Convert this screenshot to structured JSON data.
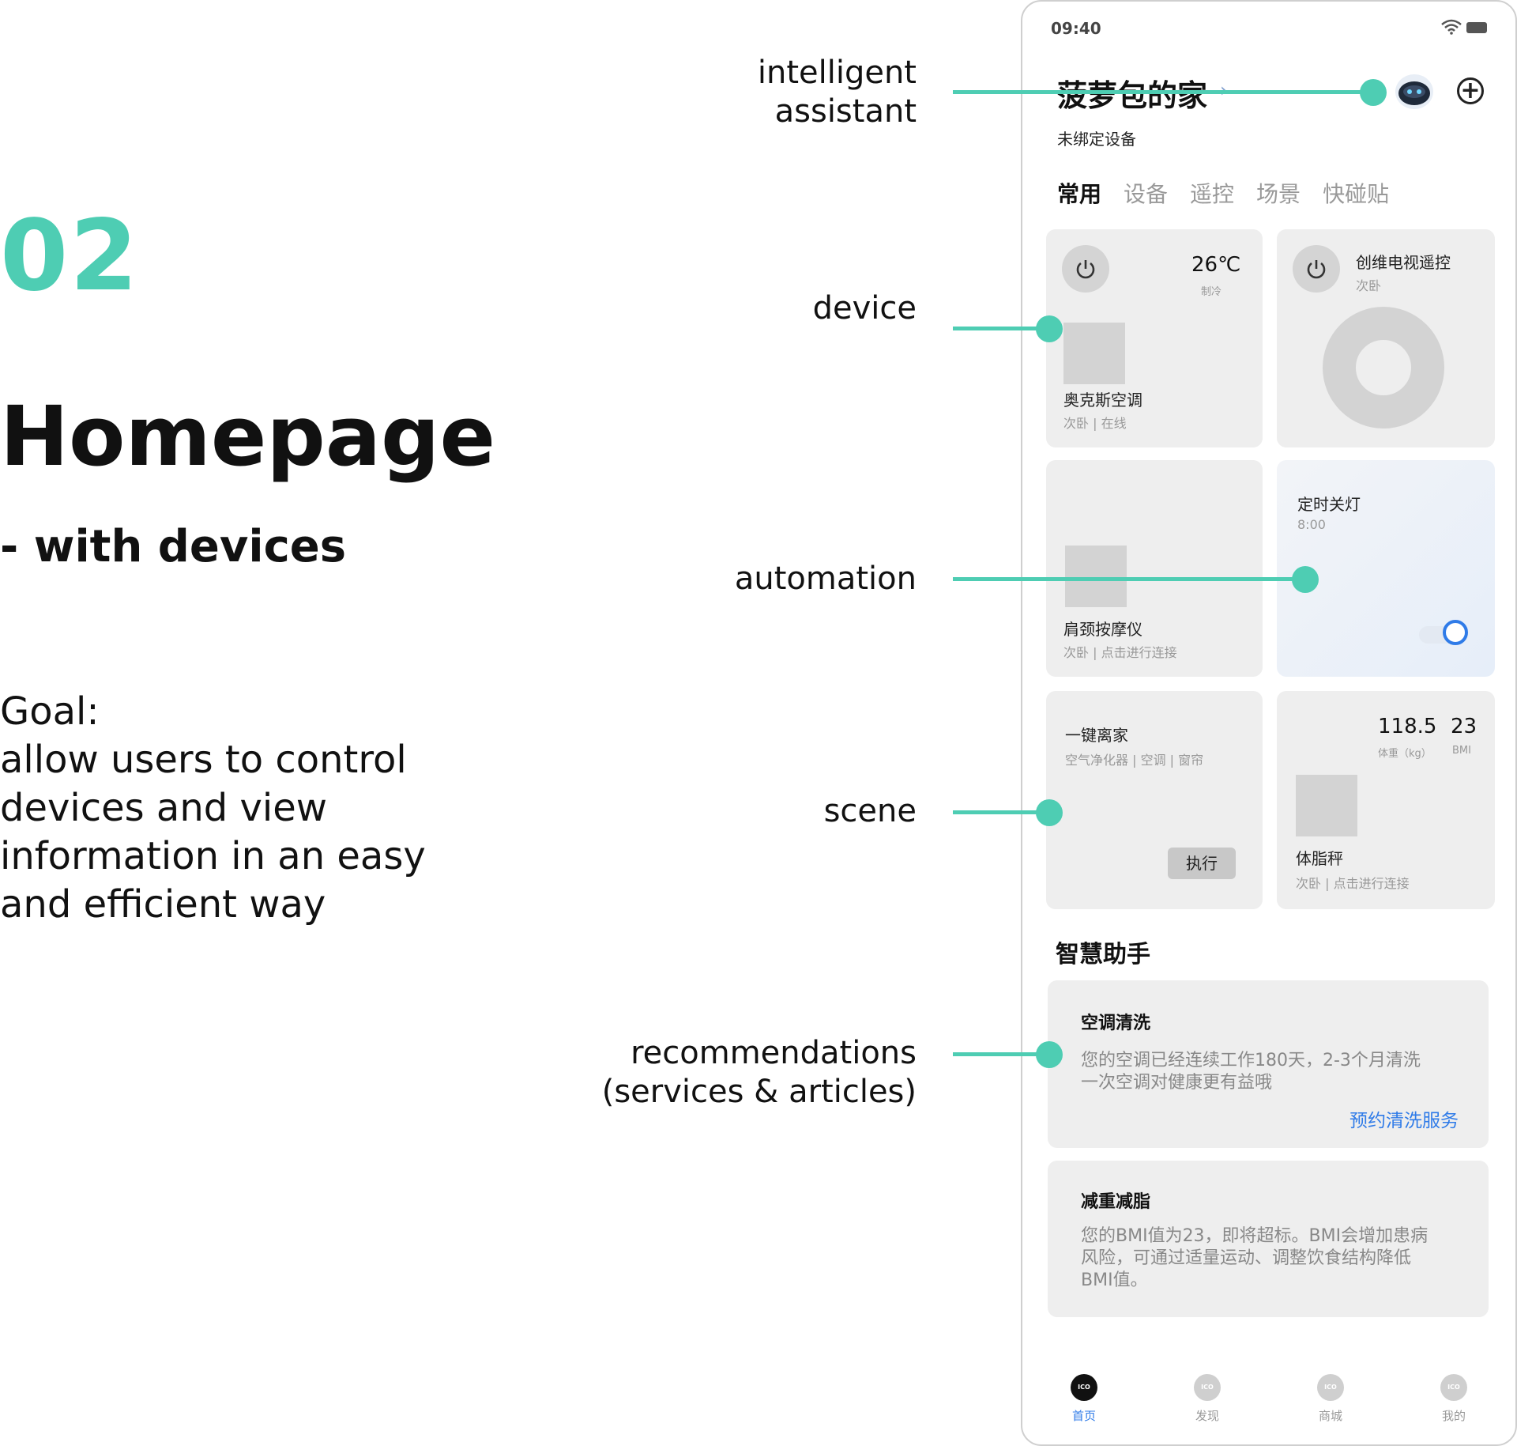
{
  "slide": {
    "number": "02",
    "title": "Homepage",
    "subtitle": "- with devices",
    "goal_lines": [
      "Goal:",
      "allow users to control",
      "devices and view",
      "information in an easy",
      "and efficient way"
    ]
  },
  "annotations": {
    "assistant": [
      "intelligent",
      "assistant"
    ],
    "device": "device",
    "automation": "automation",
    "scene": "scene",
    "recommendations": [
      "recommendations",
      "(services & articles)"
    ]
  },
  "colors": {
    "accent": "#4ECDB3",
    "link": "#2F7BE8",
    "card": "#EEEEEE",
    "toggle": "#2F7BE8"
  },
  "phone": {
    "status": {
      "time": "09:40",
      "icons": [
        "wifi-icon",
        "battery-icon"
      ]
    },
    "header": {
      "home_name": "菠萝包的家",
      "arrow": "›",
      "add_symbol": "+",
      "unbound": "未绑定设备"
    },
    "tabs": [
      "常用",
      "设备",
      "遥控",
      "场景",
      "快碰贴"
    ],
    "cards": {
      "ac": {
        "temp": "26℃",
        "mode": "制冷",
        "name": "奥克斯空调",
        "sub": "次卧 | 在线"
      },
      "tv": {
        "name": "创维电视遥控",
        "sub": "次卧"
      },
      "massager": {
        "name": "肩颈按摩仪",
        "sub": "次卧 | 点击进行连接"
      },
      "automation": {
        "name": "定时关灯",
        "time": "8:00",
        "enabled": true
      },
      "scene": {
        "name": "一键离家",
        "sub": "空气净化器 | 空调 | 窗帘",
        "button": "执行"
      },
      "scale": {
        "weight": "118.5",
        "weight_label": "体重（kg）",
        "bmi": "23",
        "bmi_label": "BMI",
        "name": "体脂秤",
        "sub": "次卧 | 点击进行连接"
      }
    },
    "assistant_section": {
      "title": "智慧助手",
      "items": [
        {
          "title": "空调清洗",
          "body_lines": [
            "您的空调已经连续工作180天，2-3个月清洗",
            "一次空调对健康更有益哦"
          ],
          "link": "预约清洗服务"
        },
        {
          "title": "减重减脂",
          "body_lines": [
            "您的BMI值为23，即将超标。BMI会增加患病",
            "风险，可通过适量运动、调整饮食结构降低",
            "BMI值。"
          ]
        }
      ]
    },
    "bottom_nav": [
      {
        "label": "首页",
        "icon_text": "ICO",
        "active": true
      },
      {
        "label": "发现",
        "icon_text": "ICO",
        "active": false
      },
      {
        "label": "商城",
        "icon_text": "ICO",
        "active": false
      },
      {
        "label": "我的",
        "icon_text": "ICO",
        "active": false
      }
    ]
  }
}
